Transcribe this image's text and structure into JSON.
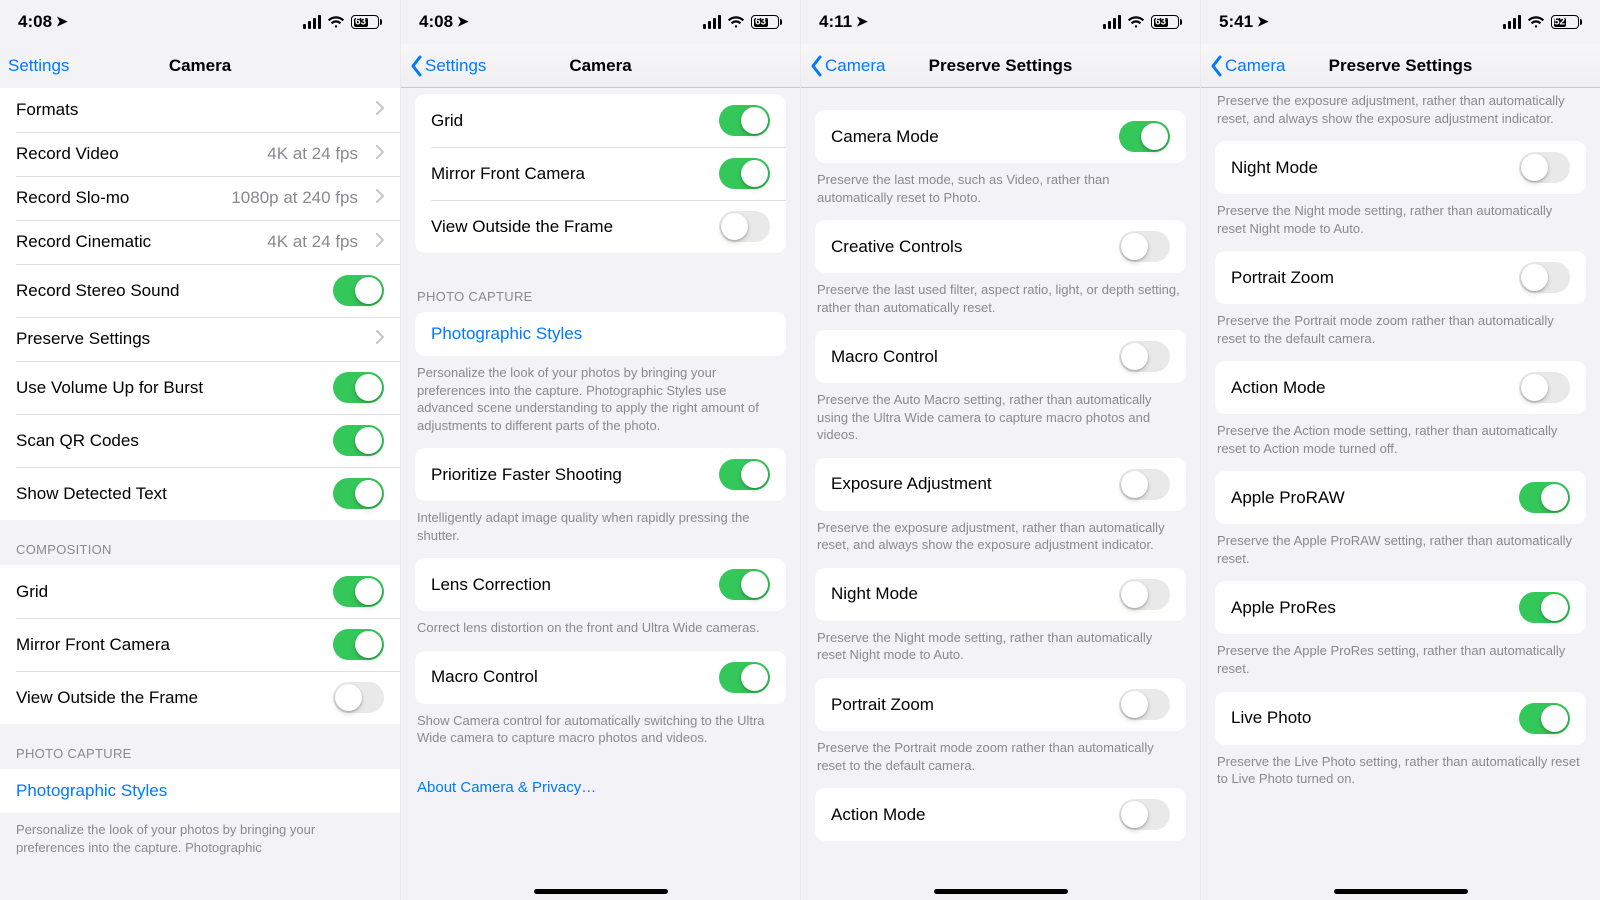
{
  "panes": [
    {
      "status": {
        "time": "4:08",
        "battery": "63",
        "battery_pct": 63
      },
      "nav": {
        "back": "Settings",
        "title": "Camera",
        "show_chevron": false,
        "flat": true
      },
      "show_home_indicator": false,
      "sections": [
        {
          "header": null,
          "footer": null,
          "edge": true,
          "first": true,
          "cells": [
            {
              "label": "Formats",
              "kind": "disclosure"
            },
            {
              "label": "Record Video",
              "kind": "detail",
              "detail": "4K at 24 fps"
            },
            {
              "label": "Record Slo-mo",
              "kind": "detail",
              "detail": "1080p at 240 fps"
            },
            {
              "label": "Record Cinematic",
              "kind": "detail",
              "detail": "4K at 24 fps"
            },
            {
              "label": "Record Stereo Sound",
              "kind": "switch",
              "on": true
            },
            {
              "label": "Preserve Settings",
              "kind": "disclosure"
            },
            {
              "label": "Use Volume Up for Burst",
              "kind": "switch",
              "on": true
            },
            {
              "label": "Scan QR Codes",
              "kind": "switch",
              "on": true
            },
            {
              "label": "Show Detected Text",
              "kind": "switch",
              "on": true
            }
          ]
        },
        {
          "header": "COMPOSITION",
          "footer": null,
          "edge": true,
          "cells": [
            {
              "label": "Grid",
              "kind": "switch",
              "on": true
            },
            {
              "label": "Mirror Front Camera",
              "kind": "switch",
              "on": true
            },
            {
              "label": "View Outside the Frame",
              "kind": "switch",
              "on": false
            }
          ]
        },
        {
          "header": "PHOTO CAPTURE",
          "edge": true,
          "footer": "Personalize the look of your photos by bringing your preferences into the capture. Photographic",
          "cells": [
            {
              "label": "Photographic Styles",
              "kind": "link"
            }
          ]
        }
      ]
    },
    {
      "status": {
        "time": "4:08",
        "battery": "63",
        "battery_pct": 63
      },
      "nav": {
        "back": "Settings",
        "title": "Camera",
        "show_chevron": true,
        "flat": false
      },
      "show_home_indicator": true,
      "sections": [
        {
          "header": null,
          "footer": null,
          "cells": [
            {
              "label": "Grid",
              "kind": "switch",
              "on": true
            },
            {
              "label": "Mirror Front Camera",
              "kind": "switch",
              "on": true
            },
            {
              "label": "View Outside the Frame",
              "kind": "switch",
              "on": false
            }
          ]
        },
        {
          "header": "PHOTO CAPTURE",
          "footer": "Personalize the look of your photos by bringing your preferences into the capture. Photographic Styles use advanced scene understanding to apply the right amount of adjustments to different parts of the photo.",
          "cells": [
            {
              "label": "Photographic Styles",
              "kind": "link"
            }
          ]
        },
        {
          "header": null,
          "footer": "Intelligently adapt image quality when rapidly pressing the shutter.",
          "cells": [
            {
              "label": "Prioritize Faster Shooting",
              "kind": "switch",
              "on": true
            }
          ]
        },
        {
          "header": null,
          "footer": "Correct lens distortion on the front and Ultra Wide cameras.",
          "cells": [
            {
              "label": "Lens Correction",
              "kind": "switch",
              "on": true
            }
          ]
        },
        {
          "header": null,
          "footer": "Show Camera control for automatically switching to the Ultra Wide camera to capture macro photos and videos.",
          "cells": [
            {
              "label": "Macro Control",
              "kind": "switch",
              "on": true
            }
          ]
        }
      ],
      "about": "About Camera & Privacy…"
    },
    {
      "status": {
        "time": "4:11",
        "battery": "63",
        "battery_pct": 63
      },
      "nav": {
        "back": "Camera",
        "title": "Preserve Settings",
        "show_chevron": true,
        "flat": false
      },
      "show_home_indicator": true,
      "sections": [
        {
          "header": null,
          "footer": "Preserve the last mode, such as Video, rather than automatically reset to Photo.",
          "top_space": true,
          "cells": [
            {
              "label": "Camera Mode",
              "kind": "switch",
              "on": true
            }
          ]
        },
        {
          "header": null,
          "footer": "Preserve the last used filter, aspect ratio, light, or depth setting, rather than automatically reset.",
          "cells": [
            {
              "label": "Creative Controls",
              "kind": "switch",
              "on": false
            }
          ]
        },
        {
          "header": null,
          "footer": "Preserve the Auto Macro setting, rather than automatically using the Ultra Wide camera to capture macro photos and videos.",
          "cells": [
            {
              "label": "Macro Control",
              "kind": "switch",
              "on": false
            }
          ]
        },
        {
          "header": null,
          "footer": "Preserve the exposure adjustment, rather than automatically reset, and always show the exposure adjustment indicator.",
          "cells": [
            {
              "label": "Exposure Adjustment",
              "kind": "switch",
              "on": false
            }
          ]
        },
        {
          "header": null,
          "footer": "Preserve the Night mode setting, rather than automatically reset Night mode to Auto.",
          "cells": [
            {
              "label": "Night Mode",
              "kind": "switch",
              "on": false
            }
          ]
        },
        {
          "header": null,
          "footer": "Preserve the Portrait mode zoom rather than automatically reset to the default camera.",
          "cells": [
            {
              "label": "Portrait Zoom",
              "kind": "switch",
              "on": false
            }
          ]
        },
        {
          "header": null,
          "footer": null,
          "cells": [
            {
              "label": "Action Mode",
              "kind": "switch",
              "on": false
            }
          ]
        }
      ]
    },
    {
      "status": {
        "time": "5:41",
        "battery": "52",
        "battery_pct": 52
      },
      "nav": {
        "back": "Camera",
        "title": "Preserve Settings",
        "show_chevron": true,
        "flat": false
      },
      "show_home_indicator": true,
      "lead_footer": "Preserve the exposure adjustment, rather than automatically reset, and always show the exposure adjustment indicator.",
      "sections": [
        {
          "header": null,
          "footer": "Preserve the Night mode setting, rather than automatically reset Night mode to Auto.",
          "cells": [
            {
              "label": "Night Mode",
              "kind": "switch",
              "on": false
            }
          ]
        },
        {
          "header": null,
          "footer": "Preserve the Portrait mode zoom rather than automatically reset to the default camera.",
          "cells": [
            {
              "label": "Portrait Zoom",
              "kind": "switch",
              "on": false
            }
          ]
        },
        {
          "header": null,
          "footer": "Preserve the Action mode setting, rather than automatically reset to Action mode turned off.",
          "cells": [
            {
              "label": "Action Mode",
              "kind": "switch",
              "on": false
            }
          ]
        },
        {
          "header": null,
          "footer": "Preserve the Apple ProRAW setting, rather than automatically reset.",
          "cells": [
            {
              "label": "Apple ProRAW",
              "kind": "switch",
              "on": true
            }
          ]
        },
        {
          "header": null,
          "footer": "Preserve the Apple ProRes setting, rather than automatically reset.",
          "cells": [
            {
              "label": "Apple ProRes",
              "kind": "switch",
              "on": true
            }
          ]
        },
        {
          "header": null,
          "footer": "Preserve the Live Photo setting, rather than automatically reset to Live Photo turned on.",
          "cells": [
            {
              "label": "Live Photo",
              "kind": "switch",
              "on": true
            }
          ]
        }
      ]
    }
  ]
}
